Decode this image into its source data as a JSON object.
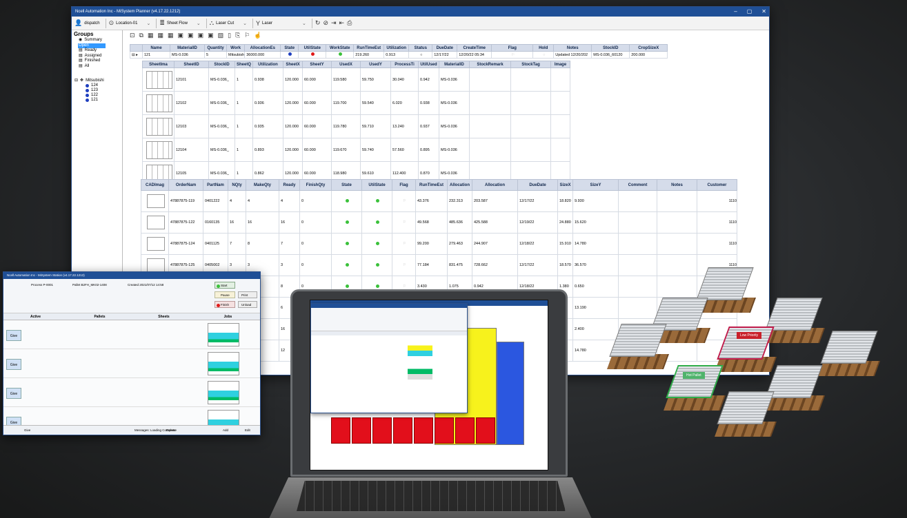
{
  "app": {
    "title": "Ncell Automation Inc - MiSystem Planner (v4.17.22.1212)",
    "user": "dispatch",
    "location": "Location-01",
    "flow": "Sheet Flow",
    "process": "Laser Cut",
    "machine": "Laser"
  },
  "sidebar": {
    "header": "Groups",
    "groups": [
      "Summary",
      "Open",
      "Ready",
      "Assigned",
      "Finished",
      "All"
    ],
    "selected": "Open",
    "tree_root": "Mitsubishi",
    "tree_items": [
      "124",
      "123",
      "122",
      "121"
    ]
  },
  "jobs": {
    "headers": [
      "Name",
      "MaterialID",
      "Quantity",
      "Work",
      "AllocationEs",
      "State",
      "UtilState",
      "WorkState",
      "RunTimeEst",
      "Utilization",
      "Status",
      "DueDate",
      "CreateTime",
      "Flag",
      "Hold",
      "Notes",
      "StockID",
      "CropSizeX"
    ],
    "row": [
      "121",
      "MS-0.036",
      "5",
      "Mitsubish",
      "36000.000",
      "",
      "",
      "",
      "219.260",
      "0.913",
      "",
      "12/17/22",
      "12/20/22 05:34",
      "",
      "",
      "Updated 12/20/202",
      "MS-0.036_60120",
      "200.000"
    ]
  },
  "sheets": {
    "headers": [
      "SheetIma",
      "SheetID",
      "StockID",
      "SheetQ",
      "Utilization",
      "SheetX",
      "SheetY",
      "UsedX",
      "UsedY",
      "ProcessTi",
      "UtilUsed",
      "MaterialID",
      "StockRemark",
      "StockTag",
      "Image"
    ],
    "rows": [
      [
        "12101",
        "MS-0.036_",
        "1",
        "0.938",
        "120.000",
        "60.000",
        "119.580",
        "59.750",
        "30.040",
        "0.942",
        "MS-0.036"
      ],
      [
        "12102",
        "MS-0.036_",
        "1",
        "0.936",
        "120.000",
        "60.000",
        "119.700",
        "59.540",
        "6.020",
        "0.938",
        "MS-0.036"
      ],
      [
        "12103",
        "MS-0.036_",
        "1",
        "0.935",
        "120.000",
        "60.000",
        "119.780",
        "59.710",
        "13.240",
        "0.937",
        "MS-0.036"
      ],
      [
        "12104",
        "MS-0.036_",
        "1",
        "0.893",
        "120.000",
        "60.000",
        "119.670",
        "59.740",
        "57.560",
        "0.895",
        "MS-0.036"
      ],
      [
        "12105",
        "MS-0.036_",
        "1",
        "0.862",
        "120.000",
        "60.000",
        "118.980",
        "59.610",
        "112.400",
        "0.870",
        "MS-0.036"
      ]
    ]
  },
  "parts": {
    "headers": [
      "CADImag",
      "OrderNam",
      "PartNam",
      "NQty",
      "MakeQty",
      "Ready",
      "FinishQty",
      "State",
      "UtilState",
      "Flag",
      "RunTimeEst",
      "Allocation",
      "Allocation",
      "DueDate",
      "SizeX",
      "SizeY",
      "Comment",
      "Notes",
      "Customer"
    ],
    "rows": [
      [
        "47887875-119",
        "0401222",
        "4",
        "4",
        "4",
        "0",
        "43.376",
        "232.313",
        "203.587",
        "12/17/22",
        "18.820",
        "9.930",
        "1110"
      ],
      [
        "47887875-122",
        "0160135",
        "16",
        "16",
        "16",
        "0",
        "49.568",
        "485.636",
        "425.588",
        "12/19/22",
        "24.880",
        "15.620",
        "1110"
      ],
      [
        "47887875-124",
        "0401125",
        "7",
        "8",
        "7",
        "0",
        "99.200",
        "279.463",
        "244.907",
        "12/18/22",
        "15.910",
        "14.780",
        "1110"
      ],
      [
        "47887875-125",
        "0405002",
        "3",
        "3",
        "3",
        "0",
        "77.184",
        "831.475",
        "728.662",
        "12/17/22",
        "18.570",
        "36.570",
        "1110"
      ]
    ],
    "partial": [
      [
        "8",
        "0",
        "3.430",
        "1.075",
        "0.942",
        "12/18/22",
        "1.380",
        "0.650"
      ],
      [
        "6",
        "",
        "",
        "",
        "",
        "",
        "000",
        "13.190"
      ],
      [
        "16",
        "",
        "",
        "",
        "",
        "",
        "00",
        "2.400"
      ],
      [
        "12",
        "",
        "",
        "",
        "",
        "",
        "910",
        "14.780"
      ]
    ]
  },
  "small_window": {
    "title": "Ncell Automation Inc - MiSystem Station (v4.17.22.1213)",
    "process": "Process  P-0001",
    "pallet": "Pallet  B2FH_MK02-1408",
    "created": "Created  2021/07/12 14:58",
    "tabs": [
      "Active",
      "Pallets",
      "Sheets",
      "Jobs"
    ],
    "buttons": [
      "Start",
      "Pause",
      "Finish",
      "Print",
      "Unload"
    ],
    "row_btn": "Give",
    "browse": "Browse",
    "add": "Add",
    "edit": "Edit",
    "status": "Messages: Loading Complete",
    "footer_left": "Give"
  },
  "pallets": {
    "low_priority": "Low Priority",
    "high_priority": "Hot Pallet"
  }
}
